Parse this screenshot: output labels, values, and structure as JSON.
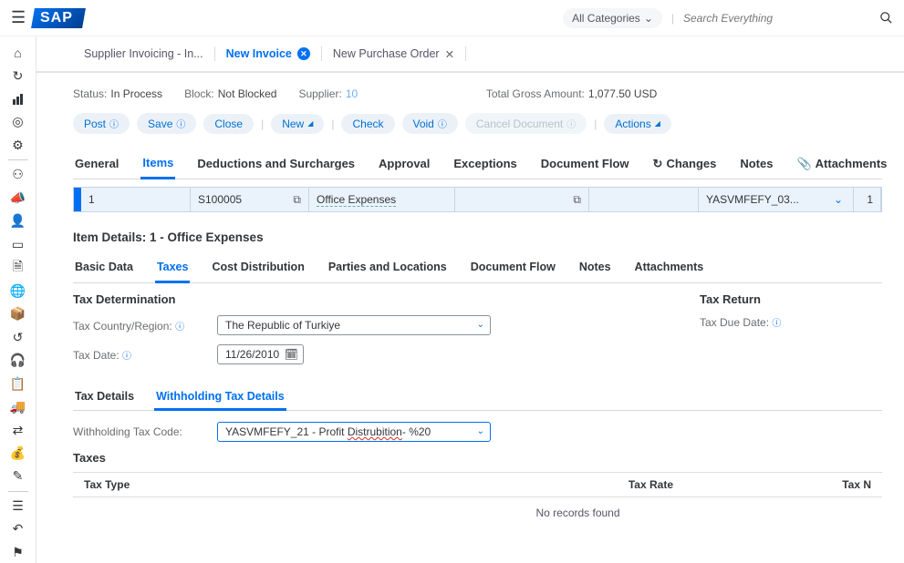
{
  "top": {
    "all_categories": "All Categories",
    "search_placeholder": "Search Everything"
  },
  "worktabs": {
    "t1": "Supplier Invoicing - In...",
    "t2": "New Invoice",
    "t3": "New Purchase Order"
  },
  "status": {
    "status_lbl": "Status:",
    "status_val": "In Process",
    "block_lbl": "Block:",
    "block_val": "Not Blocked",
    "supplier_lbl": "Supplier:",
    "supplier_val": "10",
    "gross_lbl": "Total Gross Amount:",
    "gross_val": "1,077.50 USD"
  },
  "toolbar": {
    "post": "Post",
    "save": "Save",
    "close": "Close",
    "new": "New",
    "check": "Check",
    "void": "Void",
    "cancel": "Cancel Document",
    "actions": "Actions"
  },
  "tabs2": {
    "general": "General",
    "items": "Items",
    "ded": "Deductions and Surcharges",
    "approval": "Approval",
    "exc": "Exceptions",
    "docflow": "Document Flow",
    "changes": "Changes",
    "notes": "Notes",
    "attach": "Attachments"
  },
  "row": {
    "line": "1",
    "product": "S100005",
    "desc": "Office Expenses",
    "code": "YASVMFEFY_03...",
    "last": "1"
  },
  "item_details_title": "Item Details: 1 - Office Expenses",
  "tabs3": {
    "basic": "Basic Data",
    "taxes": "Taxes",
    "cost": "Cost Distribution",
    "parties": "Parties and Locations",
    "docflow": "Document Flow",
    "notes": "Notes",
    "attach": "Attachments"
  },
  "taxdet": {
    "heading": "Tax Determination",
    "country_lbl": "Tax Country/Region:",
    "country_val": "The Republic of Turkiye",
    "date_lbl": "Tax Date:",
    "date_val": "11/26/2010"
  },
  "taxret": {
    "heading": "Tax Return",
    "due_lbl": "Tax Due Date:"
  },
  "subtabs": {
    "details": "Tax Details",
    "withholding": "Withholding Tax Details"
  },
  "withholding": {
    "code_lbl": "Withholding Tax Code:",
    "code_val_a": "YASVMFEFY_21 - Profit ",
    "code_val_b": "Distrubition",
    "code_val_c": "- %20"
  },
  "taxes": {
    "heading": "Taxes",
    "col_type": "Tax Type",
    "col_rate": "Tax Rate",
    "col_n": "Tax N",
    "norec": "No records found"
  }
}
